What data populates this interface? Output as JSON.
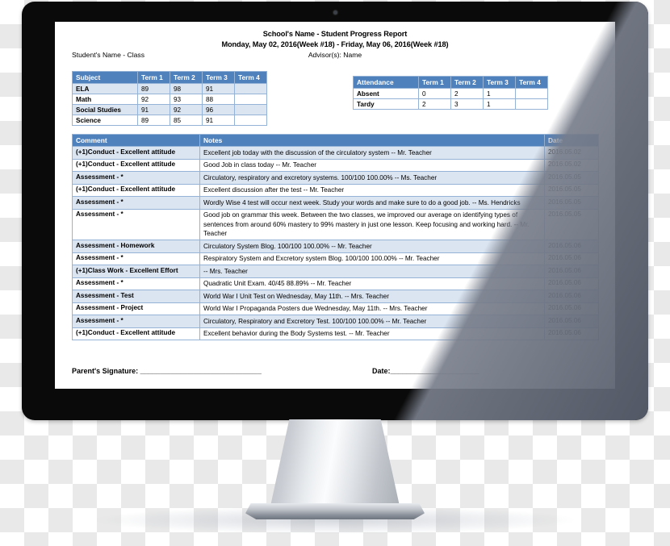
{
  "device": {
    "type": "desktop-monitor",
    "bezel_color": "#0a0a0a",
    "stand_color": "#c3c7cd"
  },
  "document": {
    "title": "School's Name - Student Progress Report",
    "date_range": "Monday, May 02, 2016(Week #18) - Friday, May 06, 2016(Week #18)",
    "student_line": "Student's Name - Class",
    "advisor_line": "Advisor(s): Name",
    "accent_color": "#4f81bd",
    "row_alt_color": "#dbe5f1",
    "border_color": "#95b3d7",
    "grades_table": {
      "headers": [
        "Subject",
        "Term 1",
        "Term 2",
        "Term 3",
        "Term 4"
      ],
      "rows": [
        {
          "subject": "ELA",
          "term1": "89",
          "term2": "98",
          "term3": "91",
          "term4": ""
        },
        {
          "subject": "Math",
          "term1": "92",
          "term2": "93",
          "term3": "88",
          "term4": ""
        },
        {
          "subject": "Social Studies",
          "term1": "91",
          "term2": "92",
          "term3": "96",
          "term4": ""
        },
        {
          "subject": "Science",
          "term1": "89",
          "term2": "85",
          "term3": "91",
          "term4": ""
        }
      ]
    },
    "attendance_table": {
      "headers": [
        "Attendance",
        "Term 1",
        "Term 2",
        "Term 3",
        "Term 4"
      ],
      "rows": [
        {
          "kind": "Absent",
          "term1": "0",
          "term2": "2",
          "term3": "1",
          "term4": ""
        },
        {
          "kind": "Tardy",
          "term1": "2",
          "term2": "3",
          "term3": "1",
          "term4": ""
        }
      ]
    },
    "comments_table": {
      "headers": [
        "Comment",
        "Notes",
        "Date"
      ],
      "rows": [
        {
          "comment": "(+1)Conduct - Excellent attitude",
          "notes": "Excellent job today with the discussion of the circulatory system -- Mr. Teacher",
          "date": "2016.05.02"
        },
        {
          "comment": "(+1)Conduct - Excellent attitude",
          "notes": "Good Job in class today -- Mr. Teacher",
          "date": "2016.05.02"
        },
        {
          "comment": "Assessment - *",
          "notes": "Circulatory, respiratory and excretory systems. 100/100 100.00% -- Ms. Teacher",
          "date": "2016.05.05"
        },
        {
          "comment": "(+1)Conduct - Excellent attitude",
          "notes": "Excellent discussion after the test -- Mr. Teacher",
          "date": "2016.05.05"
        },
        {
          "comment": "Assessment - *",
          "notes": "Wordly Wise 4 test will occur next week.  Study your words and make sure to do a good job. -- Ms. Hendricks",
          "date": "2016.05.05"
        },
        {
          "comment": "Assessment - *",
          "notes": "Good job on grammar this week.  Between the two classes, we improved our average on identifying types of sentences from around 60% mastery to 99% mastery in just one lesson.  Keep focusing and working hard. -- Mr. Teacher",
          "date": "2016.05.05"
        },
        {
          "comment": "Assessment - Homework",
          "notes": "Circulatory System Blog. 100/100 100.00% -- Mr. Teacher",
          "date": "2016.05.06"
        },
        {
          "comment": "Assessment - *",
          "notes": "Respiratory System and Excretory system Blog. 100/100 100.00% -- Mr. Teacher",
          "date": "2016.05.06"
        },
        {
          "comment": "(+1)Class Work - Excellent Effort",
          "notes": " -- Mrs. Teacher",
          "date": "2016.05.06"
        },
        {
          "comment": "Assessment - *",
          "notes": "Quadratic Unit Exam. 40/45 88.89% -- Mr. Teacher",
          "date": "2016.05.06"
        },
        {
          "comment": "Assessment - Test",
          "notes": "World War I Unit Test on Wednesday, May 11th. -- Mrs. Teacher",
          "date": "2016.05.06"
        },
        {
          "comment": "Assessment - Project",
          "notes": "World War I Propaganda Posters due Wednesday, May 11th. -- Mrs. Teacher",
          "date": "2016.05.06"
        },
        {
          "comment": "Assessment - *",
          "notes": "Circulatory, Respiratory and Excretory Test. 100/100 100.00% -- Mr. Teacher",
          "date": "2016.05.06"
        },
        {
          "comment": "(+1)Conduct - Excellent attitude",
          "notes": "Excellent behavior during the Body Systems test. -- Mr. Teacher",
          "date": "2016.05.06"
        }
      ]
    },
    "signature": {
      "parent_label": "Parent's Signature: ______________________________",
      "date_label": "Date:______________________"
    }
  }
}
